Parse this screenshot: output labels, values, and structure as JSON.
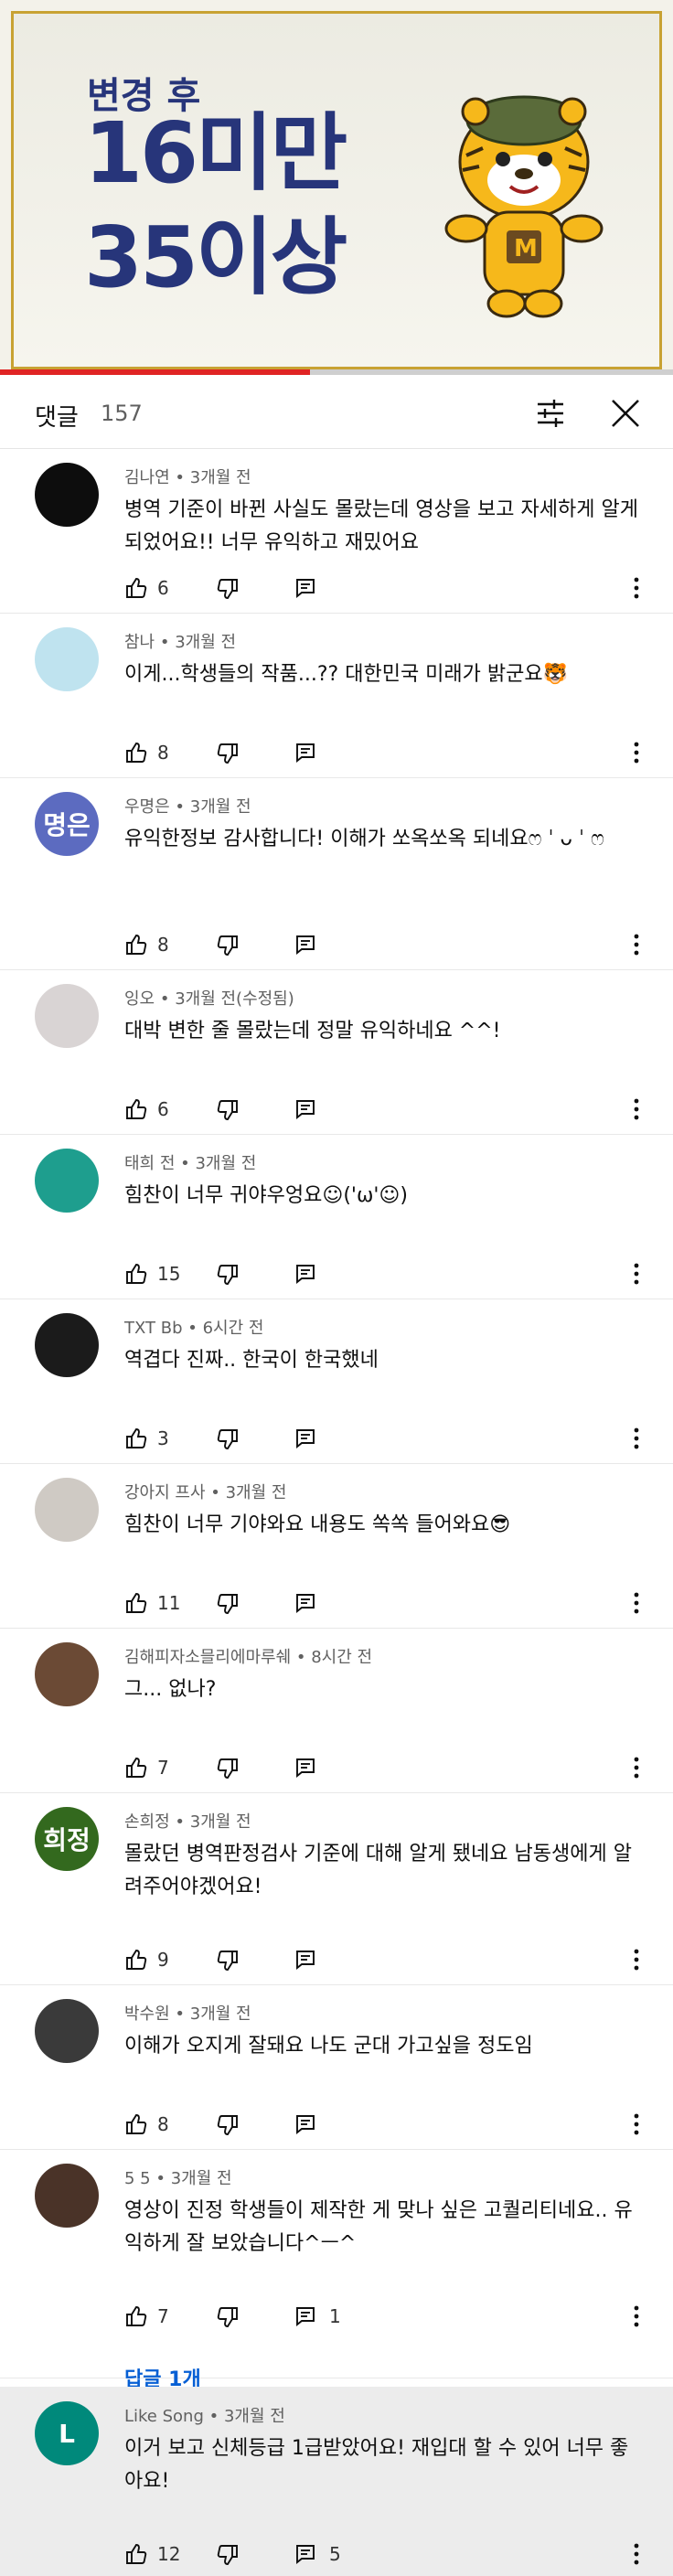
{
  "thumbnail": {
    "subtitle": "변경 후",
    "line1": "16미만",
    "line2": "35이상",
    "progress_fraction": 0.46
  },
  "header": {
    "title": "댓글",
    "count": "157"
  },
  "comments": [
    {
      "author": "김나연",
      "time": "3개월 전",
      "text": "병역 기준이 바뀐 사실도 몰랐는데 영상을 보고 자세하게 알게 되었어요!! 너무 유익하고 재밌어요",
      "likes": "6",
      "replies": "",
      "avatar_text": "",
      "avatar_color": "#0d0d0d"
    },
    {
      "author": "참나",
      "time": "3개월 전",
      "text": "이게...학생들의 작품...?? 대한민국 미래가 밝군요🐯",
      "likes": "8",
      "replies": "",
      "avatar_text": "",
      "avatar_color": "#bfe3ef"
    },
    {
      "author": "우명은",
      "time": "3개월 전",
      "text": "유익한정보 감사합니다! 이해가 쏘옥쏘옥 되네요ෆ ˈ ᴗ ˈ ෆ",
      "likes": "8",
      "replies": "",
      "avatar_text": "명은",
      "avatar_color": "#5c6bc0"
    },
    {
      "author": "잉오",
      "time": "3개월 전(수정됨)",
      "text": "대박 변한 줄 몰랐는데 정말 유익하네요 ^^!",
      "likes": "6",
      "replies": "",
      "avatar_text": "",
      "avatar_color": "#d9d4d4"
    },
    {
      "author": "태희 전",
      "time": "3개월 전",
      "text": "힘찬이 너무 귀야우엉요☺︎('ω'☺︎)",
      "likes": "15",
      "replies": "",
      "avatar_text": "",
      "avatar_color": "#1e9e8e"
    },
    {
      "author": "TXT Bb",
      "time": "6시간 전",
      "text": "역겹다 진짜.. 한국이 한국했네",
      "likes": "3",
      "replies": "",
      "avatar_text": "",
      "avatar_color": "#1b1b1b"
    },
    {
      "author": "강아지 프사",
      "time": "3개월 전",
      "text": "힘찬이 너무 기야와요 내용도 쏙쏙 들어와요😎",
      "likes": "11",
      "replies": "",
      "avatar_text": "",
      "avatar_color": "#cfcac4"
    },
    {
      "author": "김해피자소믈리에마루쉐",
      "time": "8시간 전",
      "text": "그... 없나?",
      "likes": "7",
      "replies": "",
      "avatar_text": "",
      "avatar_color": "#6b4a35"
    },
    {
      "author": "손희정",
      "time": "3개월 전",
      "text": "몰랐던 병역판정검사 기준에 대해 알게 됐네요 남동생에게 알려주어야겠어요!",
      "likes": "9",
      "replies": "",
      "avatar_text": "희정",
      "avatar_color": "#33691e"
    },
    {
      "author": "박수원",
      "time": "3개월 전",
      "text": "이해가 오지게 잘돼요 나도 군대 가고싶을 정도임",
      "likes": "8",
      "replies": "",
      "avatar_text": "",
      "avatar_color": "#3a3a3a"
    },
    {
      "author": "5 5",
      "time": "3개월 전",
      "text": "영상이 진정 학생들이 제작한 게 맞나 싶은 고퀄리티네요.. 유익하게 잘 보았습니다^ㅡ^",
      "likes": "7",
      "replies": "1",
      "avatar_text": "",
      "avatar_color": "#4a3328"
    },
    {
      "author": "Like Song",
      "time": "3개월 전",
      "text": "이거 보고 신체등급 1급받았어요! 재입대 할 수 있어 너무 좋아요!",
      "likes": "12",
      "replies": "5",
      "avatar_text": "L",
      "avatar_color": "#00897b"
    }
  ],
  "replies_link": "답글 1개"
}
